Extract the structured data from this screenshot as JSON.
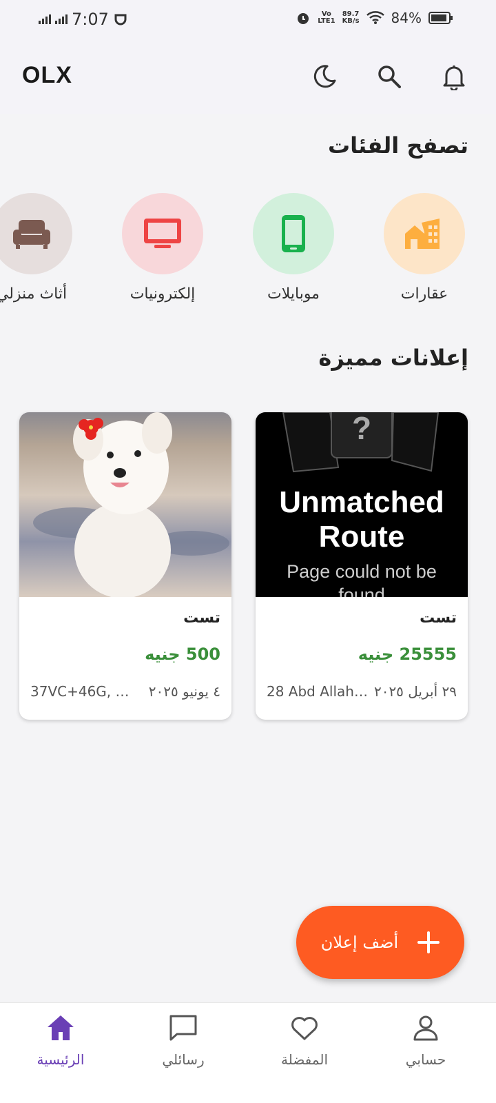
{
  "status": {
    "time": "7:07",
    "network": "LTE1",
    "speed": "89.7",
    "speed_unit": "KB/s",
    "battery": "84%"
  },
  "app": {
    "brand": "OLX"
  },
  "categories": {
    "title": "تصفح الفئات",
    "items": [
      {
        "label": "عقارات",
        "icon": "real-estate-icon",
        "color": "#fdae3f",
        "bg": "#fde5c8"
      },
      {
        "label": "موبايلات",
        "icon": "mobile-icon",
        "color": "#19b14d",
        "bg": "#d2f0dc"
      },
      {
        "label": "إلكترونيات",
        "icon": "tv-icon",
        "color": "#ee4444",
        "bg": "#f8d7da"
      },
      {
        "label": "أثاث منزلي",
        "icon": "sofa-icon",
        "color": "#7b5a51",
        "bg": "#e6dedd"
      }
    ]
  },
  "featured": {
    "title": "إعلانات مميزة",
    "ads": [
      {
        "title": "تست",
        "price": "25555 جنيه",
        "date": "٢٩ أبريل ٢٠٢٥",
        "location": "28 Abd Allah El...",
        "placeholder_title": "Unmatched Route",
        "placeholder_sub": "Page could not be found",
        "placeholder_mark": "?"
      },
      {
        "title": "تست",
        "price": "500 جنيه",
        "date": "٤ يونيو ٢٠٢٥",
        "location": "37VC+46G, AZ ..."
      }
    ]
  },
  "fab": {
    "label": "أضف إعلان"
  },
  "nav": {
    "items": [
      {
        "label": "الرئيسية",
        "icon": "home-icon",
        "active": true
      },
      {
        "label": "رسائلي",
        "icon": "message-icon"
      },
      {
        "label": "المفضلة",
        "icon": "heart-icon"
      },
      {
        "label": "حسابي",
        "icon": "profile-icon"
      }
    ],
    "active_color": "#6a3fb5"
  }
}
